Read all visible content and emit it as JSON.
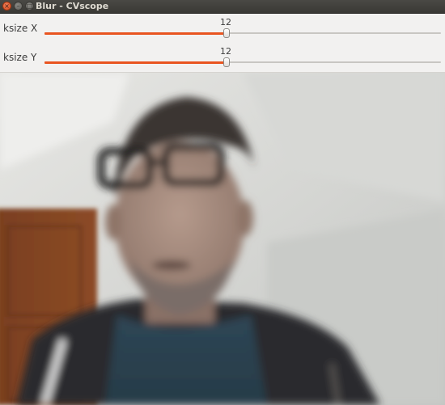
{
  "window": {
    "title": "Blur - CVscope",
    "close_glyph": "×",
    "minimize_glyph": "–",
    "maximize_glyph": "□"
  },
  "trackbars": [
    {
      "label": "ksize X",
      "value": "12",
      "min": 0,
      "max": 26,
      "fraction": 0.46
    },
    {
      "label": "ksize Y",
      "value": "12",
      "min": 0,
      "max": 26,
      "fraction": 0.46
    }
  ],
  "camera": {
    "description_hidden": "",
    "icons": [
      "person",
      "door",
      "wall"
    ]
  },
  "colors": {
    "accent": "#e95420",
    "titlebar": "#3c3b37",
    "panel": "#f2f1f0"
  }
}
